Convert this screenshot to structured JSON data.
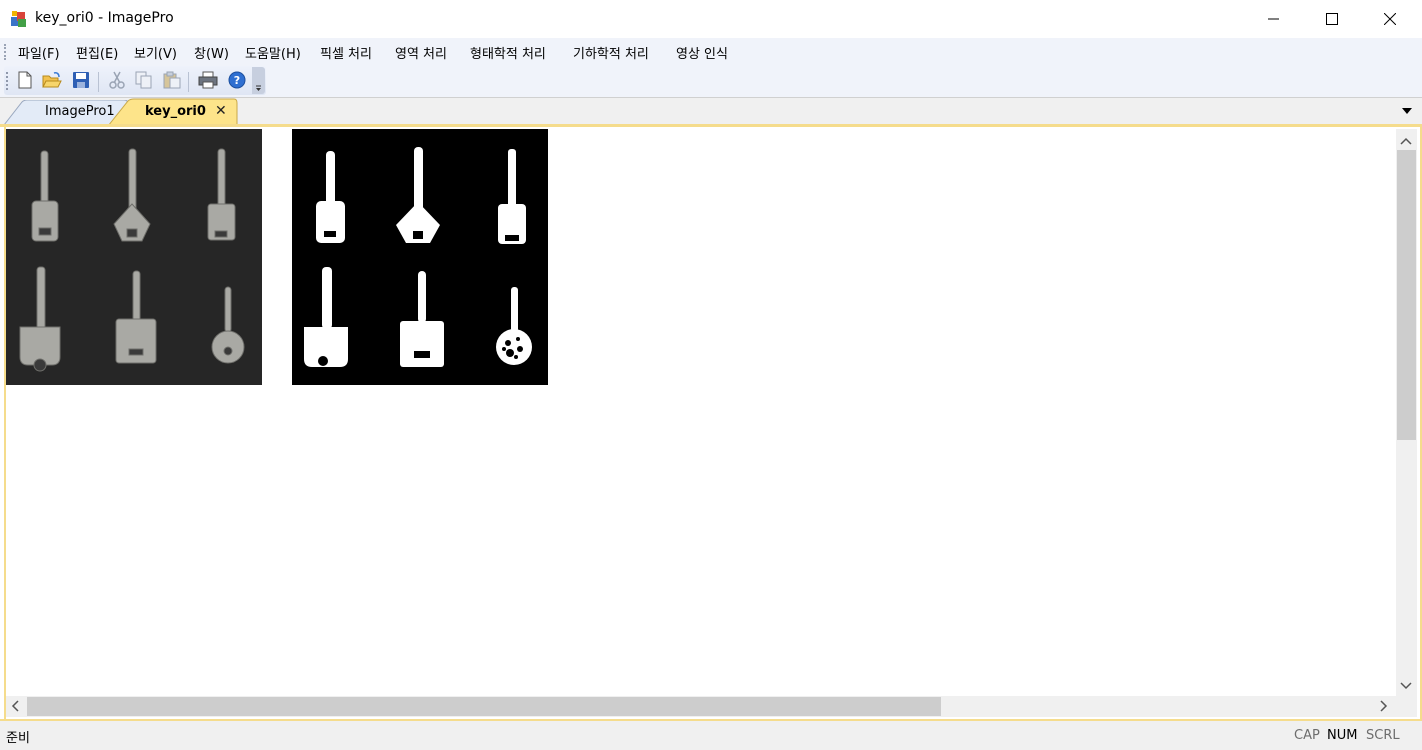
{
  "window": {
    "title": "key_ori0 - ImagePro"
  },
  "menu": [
    "파일(F)",
    "편집(E)",
    "보기(V)",
    "창(W)",
    "도움말(H)",
    "픽셀 처리",
    "영역 처리",
    "형태학적 처리",
    "기하학적 처리",
    "영상 인식"
  ],
  "toolbar": {
    "buttons": [
      "new-file-icon",
      "open-folder-icon",
      "save-icon",
      "cut-icon",
      "copy-icon",
      "paste-icon",
      "print-icon",
      "help-icon"
    ]
  },
  "tabs": [
    {
      "label": "ImagePro1",
      "active": false
    },
    {
      "label": "key_ori0",
      "active": true,
      "close": "✕"
    }
  ],
  "status": {
    "text": "준비",
    "indicators": [
      "CAP",
      "NUM",
      "SCRL"
    ]
  },
  "colors": {
    "active_tab": "#fde48a",
    "accent": "#f5dc8c",
    "toolbar": "#e6ecf8"
  }
}
